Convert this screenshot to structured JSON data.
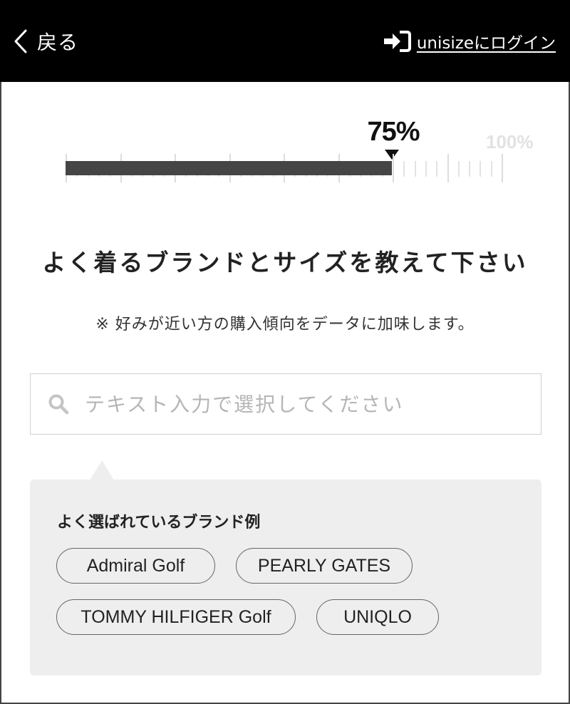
{
  "header": {
    "back_label": "戻る",
    "login_label": "unisizeにログイン"
  },
  "progress": {
    "current_label": "75%",
    "max_label": "100%",
    "value_percent": 75
  },
  "main": {
    "heading": "よく着るブランドとサイズを教えて下さい",
    "note": "※ 好みが近い方の購入傾向をデータに加味します。"
  },
  "search": {
    "placeholder": "テキスト入力で選択してください",
    "value": ""
  },
  "suggestions": {
    "title": "よく選ばれているブランド例",
    "brands": [
      "Admiral Golf",
      "PEARLY GATES",
      "TOMMY HILFIGER Golf",
      "UNIQLO"
    ]
  },
  "colors": {
    "header_bg": "#000000",
    "bar_fill": "#454545",
    "panel_bg": "#eeeeee"
  },
  "icons": {
    "back": "chevron-left-icon",
    "login": "sign-in-icon",
    "search": "search-icon"
  }
}
